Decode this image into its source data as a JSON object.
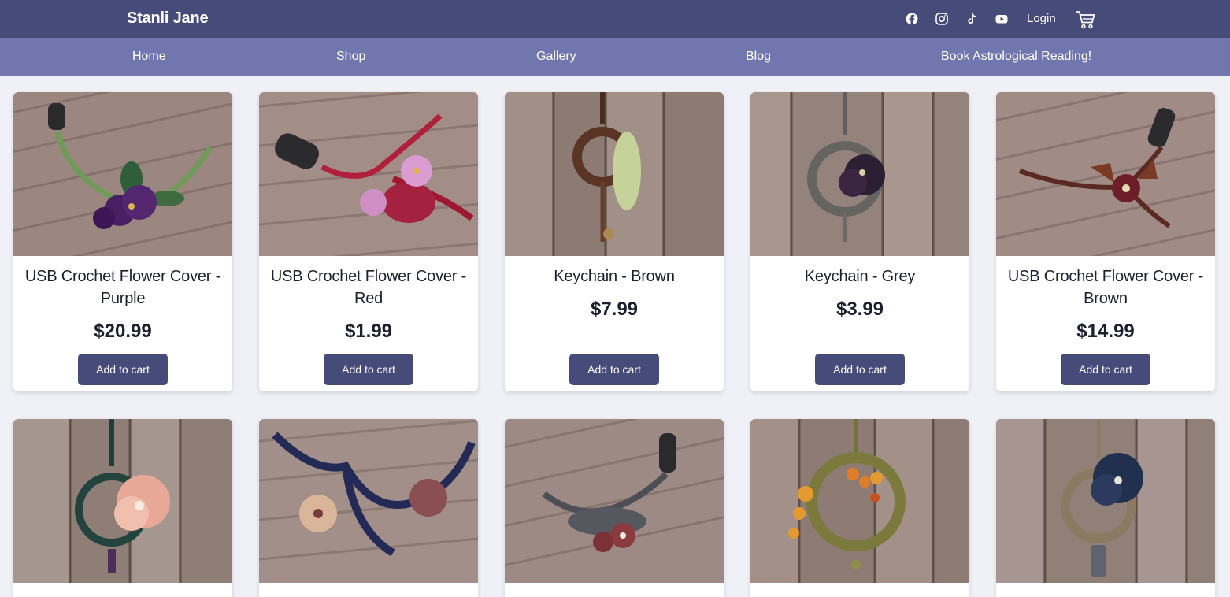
{
  "header": {
    "brand": "Stanli Jane",
    "social_icons": [
      "facebook-icon",
      "instagram-icon",
      "tiktok-icon",
      "youtube-icon"
    ],
    "login_label": "Login",
    "cart_icon": "cart-icon"
  },
  "nav": {
    "items": [
      "Home",
      "Shop",
      "Gallery",
      "Blog",
      "Book Astrological Reading!"
    ]
  },
  "products": [
    {
      "title": "USB Crochet Flower Cover - Purple",
      "price": "$20.99",
      "button": "Add to cart"
    },
    {
      "title": "USB Crochet Flower Cover - Red",
      "price": "$1.99",
      "button": "Add to cart"
    },
    {
      "title": "Keychain - Brown",
      "price": "$7.99",
      "button": "Add to cart"
    },
    {
      "title": "Keychain - Grey",
      "price": "$3.99",
      "button": "Add to cart"
    },
    {
      "title": "USB Crochet Flower Cover - Brown",
      "price": "$14.99",
      "button": "Add to cart"
    }
  ],
  "colors": {
    "topbar": "#464b7a",
    "navbar": "#7177ae",
    "background": "#f0f1f6",
    "button": "#464b7a"
  }
}
